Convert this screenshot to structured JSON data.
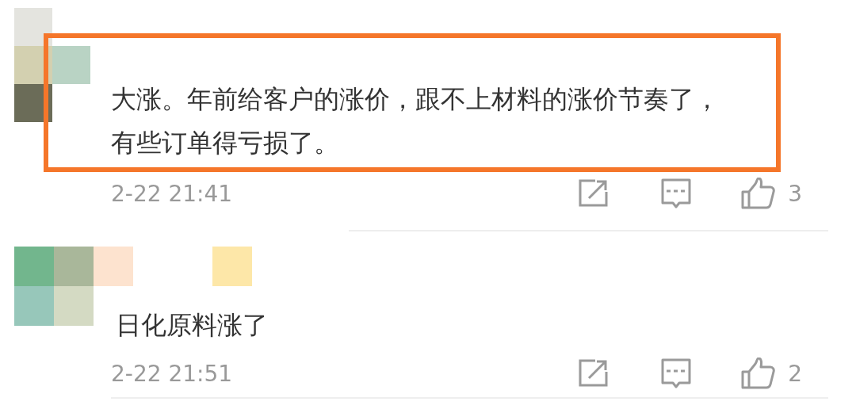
{
  "comments": [
    {
      "text": "大涨。年前给客户的涨价，跟不上材料的涨价节奏了，有些订单得亏损了。",
      "highlighted": true,
      "time": "2-22 21:41",
      "likes": "3"
    },
    {
      "text": "日化原料涨了",
      "highlighted": false,
      "time": "2-22 21:51",
      "likes": "2"
    }
  ]
}
